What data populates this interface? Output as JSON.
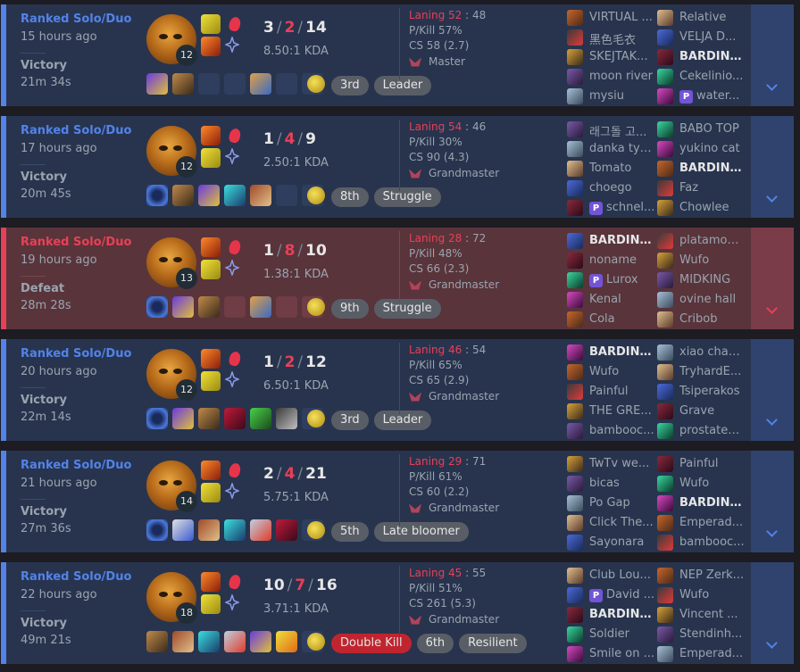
{
  "matches": [
    {
      "queue": "Ranked Solo/Duo",
      "time_ago": "15 hours ago",
      "result": "Victory",
      "duration": "21m 34s",
      "outcome": "win",
      "level": "12",
      "spell1": "flash",
      "spell2": "ignite",
      "kills": "3",
      "deaths": "2",
      "assists": "14",
      "kda_ratio": "8.50:1 KDA",
      "laning_label": "Laning 52",
      "laning_opp": "48",
      "pkill": "P/Kill 57%",
      "cs": "CS 58 (2.7)",
      "tier": "Master",
      "items": [
        "i2",
        "i3",
        "",
        "",
        "i4",
        "",
        ""
      ],
      "badges": [
        {
          "label": "3rd",
          "red": false
        },
        {
          "label": "Leader",
          "red": false
        }
      ],
      "team1": [
        {
          "name": "VIRTUAL ...",
          "me": false,
          "tag": ""
        },
        {
          "name": "黑色毛衣",
          "me": false,
          "tag": ""
        },
        {
          "name": "SKEJTAK...",
          "me": false,
          "tag": ""
        },
        {
          "name": "moon river",
          "me": false,
          "tag": ""
        },
        {
          "name": "mysiu",
          "me": false,
          "tag": ""
        }
      ],
      "team2": [
        {
          "name": "Relative",
          "me": false,
          "tag": ""
        },
        {
          "name": "VELJA D...",
          "me": false,
          "tag": ""
        },
        {
          "name": "BARDINE...",
          "me": true,
          "tag": ""
        },
        {
          "name": "Cekelinio...",
          "me": false,
          "tag": ""
        },
        {
          "name": "water...",
          "me": false,
          "tag": "P"
        }
      ]
    },
    {
      "queue": "Ranked Solo/Duo",
      "time_ago": "17 hours ago",
      "result": "Victory",
      "duration": "20m 45s",
      "outcome": "win",
      "level": "12",
      "spell1": "ignite",
      "spell2": "flash",
      "kills": "1",
      "deaths": "4",
      "assists": "9",
      "kda_ratio": "2.50:1 KDA",
      "laning_label": "Laning 54",
      "laning_opp": "46",
      "pkill": "P/Kill 30%",
      "cs": "CS 90 (4.3)",
      "tier": "Grandmaster",
      "items": [
        "i1",
        "i3",
        "i2",
        "i8",
        "i9",
        "",
        ""
      ],
      "badges": [
        {
          "label": "8th",
          "red": false
        },
        {
          "label": "Struggle",
          "red": false
        }
      ],
      "team1": [
        {
          "name": "래그돌 고...",
          "me": false,
          "tag": ""
        },
        {
          "name": "danka tyy...",
          "me": false,
          "tag": ""
        },
        {
          "name": "Tomato",
          "me": false,
          "tag": ""
        },
        {
          "name": "choego",
          "me": false,
          "tag": ""
        },
        {
          "name": "schnel...",
          "me": false,
          "tag": "P"
        }
      ],
      "team2": [
        {
          "name": "BABO TOP",
          "me": false,
          "tag": ""
        },
        {
          "name": "yukino cat",
          "me": false,
          "tag": ""
        },
        {
          "name": "BARDINE...",
          "me": true,
          "tag": ""
        },
        {
          "name": "Faz",
          "me": false,
          "tag": ""
        },
        {
          "name": "Chowlee",
          "me": false,
          "tag": ""
        }
      ]
    },
    {
      "queue": "Ranked Solo/Duo",
      "time_ago": "19 hours ago",
      "result": "Defeat",
      "duration": "28m 28s",
      "outcome": "loss",
      "level": "13",
      "spell1": "ignite",
      "spell2": "flash",
      "kills": "1",
      "deaths": "8",
      "assists": "10",
      "kda_ratio": "1.38:1 KDA",
      "laning_label": "Laning 28",
      "laning_opp": "72",
      "pkill": "P/Kill 48%",
      "cs": "CS 66 (2.3)",
      "tier": "Grandmaster",
      "items": [
        "i1",
        "i2",
        "i3",
        "",
        "i4",
        "",
        ""
      ],
      "badges": [
        {
          "label": "9th",
          "red": false
        },
        {
          "label": "Struggle",
          "red": false
        }
      ],
      "team1": [
        {
          "name": "BARDINE...",
          "me": true,
          "tag": ""
        },
        {
          "name": "noname",
          "me": false,
          "tag": ""
        },
        {
          "name": "Lurox",
          "me": false,
          "tag": "P"
        },
        {
          "name": "Kenal",
          "me": false,
          "tag": ""
        },
        {
          "name": "Cola",
          "me": false,
          "tag": ""
        }
      ],
      "team2": [
        {
          "name": "platamon...",
          "me": false,
          "tag": ""
        },
        {
          "name": "Wufo",
          "me": false,
          "tag": ""
        },
        {
          "name": "MIDKING",
          "me": false,
          "tag": ""
        },
        {
          "name": "ovine hall",
          "me": false,
          "tag": ""
        },
        {
          "name": "Cribob",
          "me": false,
          "tag": ""
        }
      ]
    },
    {
      "queue": "Ranked Solo/Duo",
      "time_ago": "20 hours ago",
      "result": "Victory",
      "duration": "22m 14s",
      "outcome": "win",
      "level": "12",
      "spell1": "ignite",
      "spell2": "flash",
      "kills": "1",
      "deaths": "2",
      "assists": "12",
      "kda_ratio": "6.50:1 KDA",
      "laning_label": "Laning 46",
      "laning_opp": "54",
      "pkill": "P/Kill 65%",
      "cs": "CS 65 (2.9)",
      "tier": "Grandmaster",
      "items": [
        "i1",
        "i2",
        "i3",
        "i5",
        "i6",
        "i7",
        ""
      ],
      "badges": [
        {
          "label": "3rd",
          "red": false
        },
        {
          "label": "Leader",
          "red": false
        }
      ],
      "team1": [
        {
          "name": "BARDINE...",
          "me": true,
          "tag": ""
        },
        {
          "name": "Wufo",
          "me": false,
          "tag": ""
        },
        {
          "name": "Painful",
          "me": false,
          "tag": ""
        },
        {
          "name": "THE GRE...",
          "me": false,
          "tag": ""
        },
        {
          "name": "bambooc...",
          "me": false,
          "tag": ""
        }
      ],
      "team2": [
        {
          "name": "xiao chao...",
          "me": false,
          "tag": ""
        },
        {
          "name": "TryhardE...",
          "me": false,
          "tag": ""
        },
        {
          "name": "Tsiperakos",
          "me": false,
          "tag": ""
        },
        {
          "name": "Grave",
          "me": false,
          "tag": ""
        },
        {
          "name": "prostatee...",
          "me": false,
          "tag": ""
        }
      ]
    },
    {
      "queue": "Ranked Solo/Duo",
      "time_ago": "21 hours ago",
      "result": "Victory",
      "duration": "27m 36s",
      "outcome": "win",
      "level": "14",
      "spell1": "ignite",
      "spell2": "flash",
      "kills": "2",
      "deaths": "4",
      "assists": "21",
      "kda_ratio": "5.75:1 KDA",
      "laning_label": "Laning 29",
      "laning_opp": "71",
      "pkill": "P/Kill 61%",
      "cs": "CS 60 (2.2)",
      "tier": "Grandmaster",
      "items": [
        "i1",
        "i10",
        "i9",
        "i8",
        "i11",
        "i5",
        ""
      ],
      "badges": [
        {
          "label": "5th",
          "red": false
        },
        {
          "label": "Late bloomer",
          "red": false
        }
      ],
      "team1": [
        {
          "name": "TwTv we...",
          "me": false,
          "tag": ""
        },
        {
          "name": "bicas",
          "me": false,
          "tag": ""
        },
        {
          "name": "Po Gap",
          "me": false,
          "tag": ""
        },
        {
          "name": "Click The...",
          "me": false,
          "tag": ""
        },
        {
          "name": "Sayonara",
          "me": false,
          "tag": ""
        }
      ],
      "team2": [
        {
          "name": "Painful",
          "me": false,
          "tag": ""
        },
        {
          "name": "Wufo",
          "me": false,
          "tag": ""
        },
        {
          "name": "BARDINE...",
          "me": true,
          "tag": ""
        },
        {
          "name": "Emperad...",
          "me": false,
          "tag": ""
        },
        {
          "name": "bambooc...",
          "me": false,
          "tag": ""
        }
      ]
    },
    {
      "queue": "Ranked Solo/Duo",
      "time_ago": "22 hours ago",
      "result": "Victory",
      "duration": "49m 21s",
      "outcome": "win",
      "level": "18",
      "spell1": "ignite",
      "spell2": "flash",
      "kills": "10",
      "deaths": "7",
      "assists": "16",
      "kda_ratio": "3.71:1 KDA",
      "laning_label": "Laning 45",
      "laning_opp": "55",
      "pkill": "P/Kill 51%",
      "cs": "CS 261 (5.3)",
      "tier": "Grandmaster",
      "items": [
        "i3",
        "i9",
        "i8",
        "i11",
        "i2",
        "i12",
        ""
      ],
      "badges": [
        {
          "label": "Double Kill",
          "red": true
        },
        {
          "label": "6th",
          "red": false
        },
        {
          "label": "Resilient",
          "red": false
        }
      ],
      "team1": [
        {
          "name": "Club Lou...",
          "me": false,
          "tag": ""
        },
        {
          "name": "David ...",
          "me": false,
          "tag": "P"
        },
        {
          "name": "BARDINE...",
          "me": true,
          "tag": ""
        },
        {
          "name": "Soldier",
          "me": false,
          "tag": ""
        },
        {
          "name": "Smile on ...",
          "me": false,
          "tag": ""
        }
      ],
      "team2": [
        {
          "name": "NEP Zerk...",
          "me": false,
          "tag": ""
        },
        {
          "name": "Wufo",
          "me": false,
          "tag": ""
        },
        {
          "name": "Vincent ...",
          "me": false,
          "tag": ""
        },
        {
          "name": "Stendinh...",
          "me": false,
          "tag": ""
        },
        {
          "name": "Emperad...",
          "me": false,
          "tag": ""
        }
      ]
    }
  ]
}
